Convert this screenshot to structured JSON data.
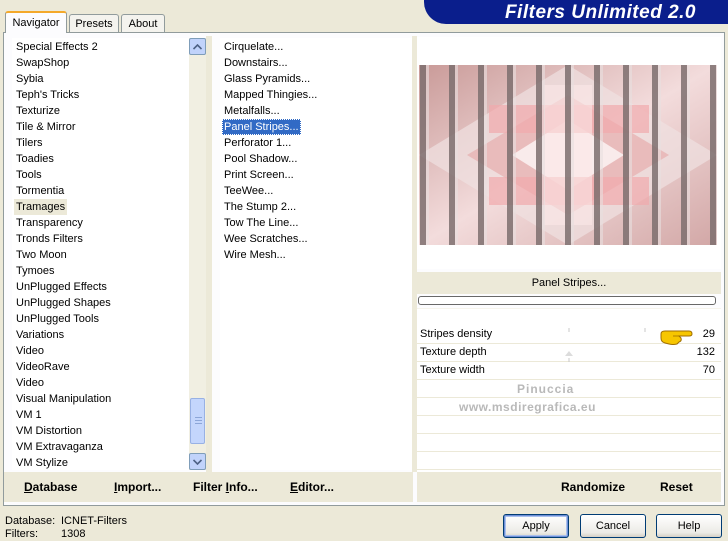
{
  "app": {
    "title": "Filters Unlimited 2.0"
  },
  "tabs": [
    {
      "label": "Navigator",
      "active": true
    },
    {
      "label": "Presets",
      "active": false
    },
    {
      "label": "About",
      "active": false
    }
  ],
  "categories": {
    "items": [
      "Special Effects 2",
      "SwapShop",
      "Sybia",
      "Teph's Tricks",
      "Texturize",
      "Tile & Mirror",
      "Tilers",
      "Toadies",
      "Tools",
      "Tormentia",
      "Tramages",
      "Transparency",
      "Tronds Filters",
      "Two Moon",
      "Tymoes",
      "UnPlugged Effects",
      "UnPlugged Shapes",
      "UnPlugged Tools",
      "Variations",
      "Video",
      "VideoRave",
      "Video",
      "Visual Manipulation",
      "VM 1",
      "VM Distortion",
      "VM Extravaganza",
      "VM Stylize"
    ],
    "selected_index": 10
  },
  "filters": {
    "items": [
      "Cirquelate...",
      "Downstairs...",
      "Glass Pyramids...",
      "Mapped Thingies...",
      "Metalfalls...",
      "Panel Stripes...",
      "Perforator 1...",
      "Pool Shadow...",
      "Print Screen...",
      "TeeWee...",
      "The Stump 2...",
      "Tow The Line...",
      "Wee Scratches...",
      "Wire Mesh..."
    ],
    "selected_index": 5
  },
  "toolbar": {
    "database": "Database",
    "import": "Import...",
    "filter_info": "Filter Info...",
    "editor": "Editor...",
    "randomize": "Randomize",
    "reset": "Reset"
  },
  "preview": {
    "filter_name": "Panel Stripes...",
    "progress": 0
  },
  "parameters": [
    {
      "label": "Stripes density",
      "value": "29",
      "slider": 0.114
    },
    {
      "label": "Texture depth",
      "value": "132",
      "slider": 0.518
    },
    {
      "label": "Texture width",
      "value": "70",
      "slider": 0.275
    }
  ],
  "watermark": {
    "line1": "Pinuccia",
    "line2": "www.msdiregrafica.eu"
  },
  "status": {
    "database_label": "Database:",
    "database_value": "ICNET-Filters",
    "filters_label": "Filters:",
    "filters_value": "1308"
  },
  "buttons": {
    "apply": "Apply",
    "cancel": "Cancel",
    "help": "Help"
  },
  "colors": {
    "banner": "#0a1e8c",
    "selection": "#316ac5",
    "tab_highlight": "#f4a92a"
  },
  "icons": {
    "scroll_up": "chevron-up-icon",
    "scroll_down": "chevron-down-icon",
    "pointer": "pointing-hand-icon"
  }
}
